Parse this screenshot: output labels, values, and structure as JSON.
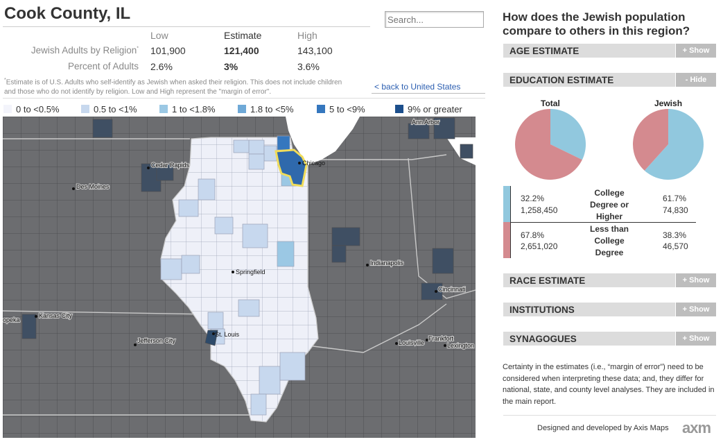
{
  "header": {
    "title": "Cook County, IL",
    "search_placeholder": "Search...",
    "back_link": "< back to United States"
  },
  "stats": {
    "columns": [
      "Low",
      "Estimate",
      "High"
    ],
    "rows": [
      {
        "label": "Jewish Adults by Religion",
        "marker": "*",
        "low": "101,900",
        "estimate": "121,400",
        "high": "143,100"
      },
      {
        "label": "Percent of Adults",
        "low": "2.6%",
        "estimate": "3%",
        "high": "3.6%"
      }
    ],
    "note_marker": "*",
    "note": "Estimate is of U.S. Adults who self-identify as Jewish when asked their religion. This does not include children and those who do not identify by religion. Low and High represent the \"margin of error\"."
  },
  "legend": [
    {
      "label": "0 to <0.5%",
      "color": "#f3f4fb"
    },
    {
      "label": "0.5 to <1%",
      "color": "#c7d8ee"
    },
    {
      "label": "1 to <1.8%",
      "color": "#9bc8e4"
    },
    {
      "label": "1.8 to <5%",
      "color": "#6fa9d7"
    },
    {
      "label": "5 to <9%",
      "color": "#3577be"
    },
    {
      "label": "9% or greater",
      "color": "#1c4f8c"
    }
  ],
  "map": {
    "cities": [
      {
        "name": "Chicago"
      },
      {
        "name": "Ann Arbor"
      },
      {
        "name": "Cedar Rapids"
      },
      {
        "name": "Des Moines"
      },
      {
        "name": "Springfield"
      },
      {
        "name": "Indianapolis"
      },
      {
        "name": "Cincinnati"
      },
      {
        "name": "Kansas City"
      },
      {
        "name": "opeka"
      },
      {
        "name": "St. Louis"
      },
      {
        "name": "Jefferson City"
      },
      {
        "name": "Louisville"
      },
      {
        "name": "Frankfort"
      },
      {
        "name": "Lexington"
      }
    ]
  },
  "panel": {
    "title": "How does the Jewish population compare to others in this region?",
    "sections": [
      {
        "label": "AGE ESTIMATE",
        "toggle": "+ Show"
      },
      {
        "label": "EDUCATION ESTIMATE",
        "toggle": "- Hide"
      },
      {
        "label": "RACE ESTIMATE",
        "toggle": "+ Show"
      },
      {
        "label": "INSTITUTIONS",
        "toggle": "+ Show"
      },
      {
        "label": "SYNAGOGUES",
        "toggle": "+ Show"
      }
    ],
    "education": {
      "pie_titles": [
        "Total",
        "Jewish"
      ],
      "rows": [
        {
          "total_pct": "32.2%",
          "total_count": "1,258,450",
          "category": "College Degree or Higher",
          "jewish_pct": "61.7%",
          "jewish_count": "74,830",
          "color": "#91c8de"
        },
        {
          "total_pct": "67.8%",
          "total_count": "2,651,020",
          "category": "Less than College Degree",
          "jewish_pct": "38.3%",
          "jewish_count": "46,570",
          "color": "#d48a8f"
        }
      ],
      "total_college_fraction": 0.322,
      "jewish_college_fraction": 0.617
    },
    "note": "Certainty in the estimates (i.e., “margin of error”) need to be considered when interpreting these data; and, they differ for national, state, and county level analyses. They are included in the main report.",
    "credit": "Designed and developed by Axis Maps",
    "logo": "axm"
  }
}
